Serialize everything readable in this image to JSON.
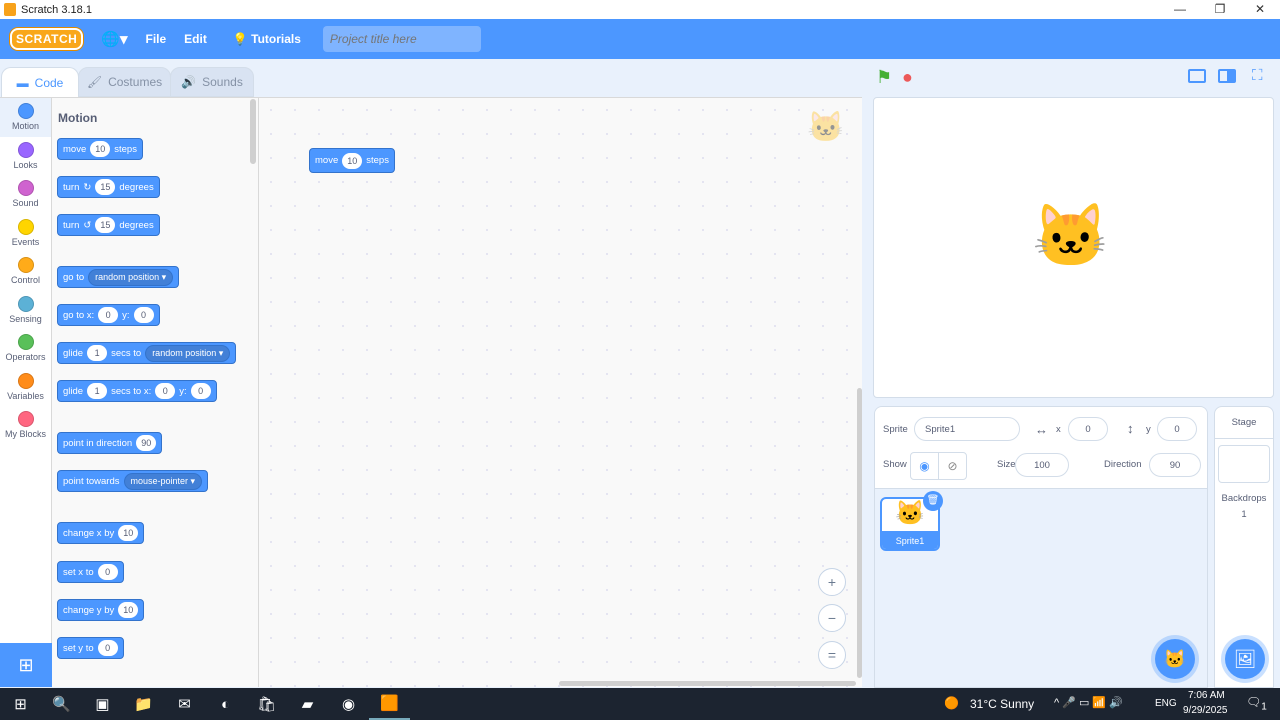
{
  "window": {
    "title": "Scratch 3.18.1",
    "minimize": "—",
    "maximize": "❐",
    "close": "✕"
  },
  "menubar": {
    "logo": "SCRATCH",
    "file": "File",
    "edit": "Edit",
    "tutorials": "Tutorials",
    "project_title_placeholder": "Project title here"
  },
  "tabs": [
    {
      "label": "Code",
      "icon": "▬"
    },
    {
      "label": "Costumes",
      "icon": "🖌"
    },
    {
      "label": "Sounds",
      "icon": "🔊"
    }
  ],
  "categories": [
    {
      "label": "Motion",
      "color": "#4c97ff"
    },
    {
      "label": "Looks",
      "color": "#9966ff"
    },
    {
      "label": "Sound",
      "color": "#cf63cf"
    },
    {
      "label": "Events",
      "color": "#ffd500"
    },
    {
      "label": "Control",
      "color": "#ffab19"
    },
    {
      "label": "Sensing",
      "color": "#5cb1d6"
    },
    {
      "label": "Operators",
      "color": "#59c059"
    },
    {
      "label": "Variables",
      "color": "#ff8c1a"
    },
    {
      "label": "My Blocks",
      "color": "#ff6680"
    }
  ],
  "palette": {
    "title": "Motion",
    "blocks": [
      [
        {
          "t": "move"
        },
        {
          "i": "10"
        },
        {
          "t": "steps"
        }
      ],
      [
        {
          "t": "turn"
        },
        {
          "t": "↻"
        },
        {
          "i": "15"
        },
        {
          "t": "degrees"
        }
      ],
      [
        {
          "t": "turn"
        },
        {
          "t": "↺"
        },
        {
          "i": "15"
        },
        {
          "t": "degrees"
        }
      ],
      [
        {
          "t": "go to"
        },
        {
          "d": "random position ▾"
        }
      ],
      [
        {
          "t": "go to x:"
        },
        {
          "i": "0"
        },
        {
          "t": "y:"
        },
        {
          "i": "0"
        }
      ],
      [
        {
          "t": "glide"
        },
        {
          "i": "1"
        },
        {
          "t": "secs to"
        },
        {
          "d": "random position ▾"
        }
      ],
      [
        {
          "t": "glide"
        },
        {
          "i": "1"
        },
        {
          "t": "secs to x:"
        },
        {
          "i": "0"
        },
        {
          "t": "y:"
        },
        {
          "i": "0"
        }
      ],
      [
        {
          "t": "point in direction"
        },
        {
          "i": "90"
        }
      ],
      [
        {
          "t": "point towards"
        },
        {
          "d": "mouse-pointer ▾"
        }
      ],
      [
        {
          "t": "change x by"
        },
        {
          "i": "10"
        }
      ],
      [
        {
          "t": "set x to"
        },
        {
          "i": "0"
        }
      ],
      [
        {
          "t": "change y by"
        },
        {
          "i": "10"
        }
      ],
      [
        {
          "t": "set y to"
        },
        {
          "i": "0"
        }
      ]
    ]
  },
  "workspace": {
    "block": [
      {
        "t": "move"
      },
      {
        "i": "10"
      },
      {
        "t": "steps"
      }
    ],
    "zoom_in": "+",
    "zoom_out": "−",
    "zoom_reset": "="
  },
  "stage_controls": {
    "flag": "⚑",
    "stop": "●"
  },
  "sprite_info": {
    "sprite_label": "Sprite",
    "sprite_name": "Sprite1",
    "x_label": "x",
    "x": "0",
    "y_label": "y",
    "y": "0",
    "show_label": "Show",
    "size_label": "Size",
    "size": "100",
    "direction_label": "Direction",
    "direction": "90"
  },
  "sprites": [
    {
      "name": "Sprite1"
    }
  ],
  "stage_selector": {
    "title": "Stage",
    "backdrops_label": "Backdrops",
    "backdrops_count": "1"
  },
  "taskbar": {
    "weather": "31°C  Sunny",
    "lang": "ENG",
    "time": "7:06 AM",
    "date": "9/29/2025",
    "notifications": "1"
  }
}
